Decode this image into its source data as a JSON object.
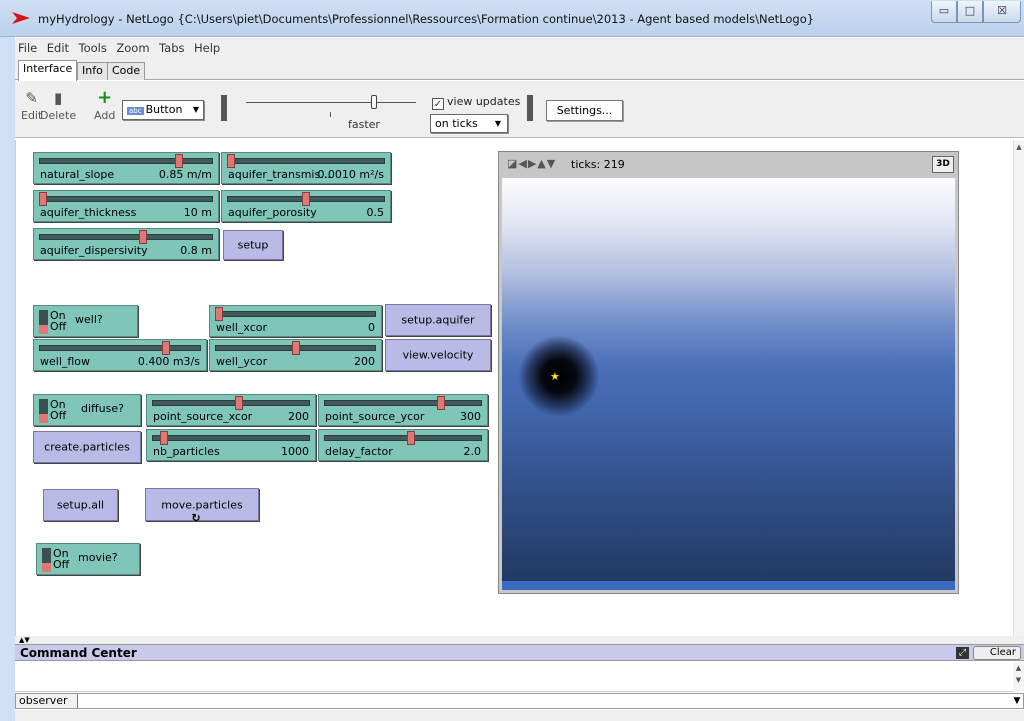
{
  "window": {
    "title": "myHydrology - NetLogo {C:\\Users\\piet\\Documents\\Professionnel\\Ressources\\Formation continue\\2013 - Agent based models\\NetLogo}",
    "controls": {
      "minimize": "▭",
      "maximize": "□",
      "close": "☒"
    }
  },
  "menu": [
    "File",
    "Edit",
    "Tools",
    "Zoom",
    "Tabs",
    "Help"
  ],
  "tabs": [
    {
      "label": "Interface",
      "active": true
    },
    {
      "label": "Info",
      "active": false
    },
    {
      "label": "Code",
      "active": false
    }
  ],
  "toolbar": {
    "edit_label": "Edit",
    "delete_label": "Delete",
    "add_label": "Add",
    "widget_type": "Button",
    "widget_type_icon": "abc",
    "speed_label": "faster",
    "view_updates_label": "view updates",
    "view_updates_checked": true,
    "update_mode": "on ticks",
    "settings_label": "Settings..."
  },
  "sliders": [
    {
      "name": "natural_slope",
      "value": "0.85 m/m",
      "position": 0.82
    },
    {
      "name": "aquifer_transmis...",
      "value": "0.0010 m²/s",
      "position": 0.0
    },
    {
      "name": "aquifer_thickness",
      "value": "10 m",
      "position": 0.0
    },
    {
      "name": "aquifer_porosity",
      "value": "0.5",
      "position": 0.5
    },
    {
      "name": "aquifer_dispersivity",
      "value": "0.8 m",
      "position": 0.6
    },
    {
      "name": "well_xcor",
      "value": "0",
      "position": 0.0
    },
    {
      "name": "well_flow",
      "value": "0.400 m3/s",
      "position": 0.8
    },
    {
      "name": "well_ycor",
      "value": "200",
      "position": 0.5
    },
    {
      "name": "point_source_xcor",
      "value": "200",
      "position": 0.55
    },
    {
      "name": "point_source_ycor",
      "value": "300",
      "position": 0.75
    },
    {
      "name": "nb_particles",
      "value": "1000",
      "position": 0.05
    },
    {
      "name": "delay_factor",
      "value": "2.0",
      "position": 0.55
    }
  ],
  "buttons": {
    "setup": "setup",
    "setup_aquifer": "setup.aquifer",
    "view_velocity": "view.velocity",
    "create_particles": "create.particles",
    "setup_all": "setup.all",
    "move_particles": "move.particles",
    "forever_icon": "↻"
  },
  "switches": [
    {
      "on_label": "On",
      "off_label": "Off",
      "name": "well?",
      "state": "off"
    },
    {
      "on_label": "On",
      "off_label": "Off",
      "name": "diffuse?",
      "state": "off"
    },
    {
      "on_label": "On",
      "off_label": "Off",
      "name": "movie?",
      "state": "off"
    }
  ],
  "view": {
    "ticks_label": "ticks: 219",
    "btn_3d": "3D",
    "well_marker": "★",
    "colors": {
      "top": "#fdfdfe",
      "mid": "#4a6fb8",
      "bottom": "#1f3761",
      "band": "#3a6bbf",
      "marker": "#ffe400"
    }
  },
  "command_center": {
    "title": "Command Center",
    "clear_label": "Clear",
    "observer_label": "observer >",
    "input_value": ""
  },
  "colors": {
    "slider_bg": "#7fc6b8",
    "button_bg": "#babae6",
    "thumb": "#e07676",
    "cc_header": "#c9c9ec"
  }
}
